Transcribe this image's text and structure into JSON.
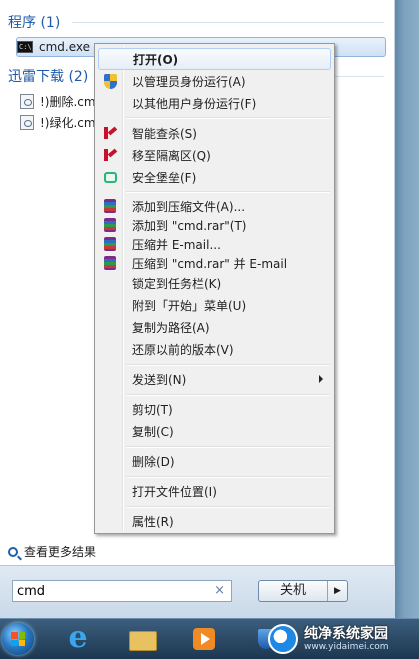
{
  "start_menu": {
    "groups": [
      {
        "header": "程序 (1)",
        "items": [
          {
            "label": "cmd.exe",
            "icon": "cmd-icon"
          }
        ]
      },
      {
        "header": "迅雷下载 (2)",
        "items": [
          {
            "label": "!)删除.cmd",
            "icon": "script-file-icon"
          },
          {
            "label": "!)绿化.cmd",
            "icon": "script-file-icon"
          }
        ]
      }
    ],
    "see_more": "查看更多结果",
    "search": {
      "value": "cmd",
      "clear_glyph": "×"
    },
    "shutdown": {
      "label": "关机",
      "arrow": "▶"
    }
  },
  "context_menu": {
    "items": [
      {
        "label": "打开(O)",
        "icon": "",
        "bold": true,
        "highlighted": true
      },
      {
        "label": "以管理员身份运行(A)",
        "icon": "uac-shield-icon"
      },
      {
        "label": "以其他用户身份运行(F)",
        "icon": ""
      },
      {
        "label": "智能查杀(S)",
        "icon": "kingsoft-k-icon"
      },
      {
        "label": "移至隔离区(Q)",
        "icon": "kingsoft-k-icon"
      },
      {
        "label": "安全堡垒(F)",
        "icon": "vault-icon"
      },
      {
        "label": "添加到压缩文件(A)...",
        "icon": "winrar-icon"
      },
      {
        "label": "添加到 \"cmd.rar\"(T)",
        "icon": "winrar-icon"
      },
      {
        "label": "压缩并 E-mail...",
        "icon": "winrar-icon"
      },
      {
        "label": "压缩到 \"cmd.rar\" 并 E-mail",
        "icon": "winrar-icon"
      },
      {
        "label": "锁定到任务栏(K)",
        "icon": ""
      },
      {
        "label": "附到「开始」菜单(U)",
        "icon": ""
      },
      {
        "label": "复制为路径(A)",
        "icon": ""
      },
      {
        "label": "还原以前的版本(V)",
        "icon": ""
      },
      {
        "label": "发送到(N)",
        "icon": "",
        "submenu": true
      },
      {
        "label": "剪切(T)",
        "icon": ""
      },
      {
        "label": "复制(C)",
        "icon": ""
      },
      {
        "label": "删除(D)",
        "icon": ""
      },
      {
        "label": "打开文件位置(I)",
        "icon": ""
      },
      {
        "label": "属性(R)",
        "icon": ""
      }
    ]
  },
  "taskbar": {
    "items": [
      "start-orb-icon",
      "internet-explorer-icon",
      "file-explorer-icon",
      "media-player-icon",
      "shield-icon"
    ]
  },
  "watermark": {
    "title": "纯净系统家园",
    "url": "www.yidaimei.com"
  },
  "colors": {
    "group_header": "#1e5aa8",
    "menu_bg": "#f0f0f0",
    "highlight_border": "#aecff7"
  }
}
